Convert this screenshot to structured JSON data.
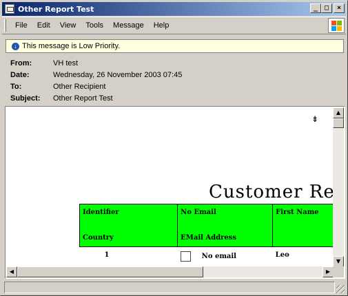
{
  "window": {
    "title": "Other Report Test",
    "minimize": "_",
    "maximize": "□",
    "close": "×"
  },
  "menu": {
    "items": [
      "File",
      "Edit",
      "View",
      "Tools",
      "Message",
      "Help"
    ]
  },
  "priority_bar": {
    "icon": "↓",
    "text": "This message is Low Priority."
  },
  "headers": [
    {
      "label": "From:",
      "value": "VH test"
    },
    {
      "label": "Date:",
      "value": "Wednesday, 26 November 2003 07:45"
    },
    {
      "label": "To:",
      "value": "Other Recipient"
    },
    {
      "label": "Subject:",
      "value": "Other Report Test"
    }
  ],
  "report": {
    "title": "Customer Repo",
    "marker": "⇟",
    "columns": [
      {
        "top": "Identifier",
        "bottom": "Country"
      },
      {
        "top": "No Email",
        "bottom": "EMail Address"
      },
      {
        "top": "First Name",
        "bottom": ""
      }
    ],
    "rows": [
      {
        "identifier": "1",
        "no_email": "No email",
        "first_name": "Leo"
      }
    ]
  },
  "scroll": {
    "up": "▲",
    "down": "▼",
    "left": "◀",
    "right": "▶"
  },
  "colors": {
    "header_green": "#00ff00",
    "titlebar_start": "#0a246a",
    "priority_bg": "#ffffe1"
  }
}
